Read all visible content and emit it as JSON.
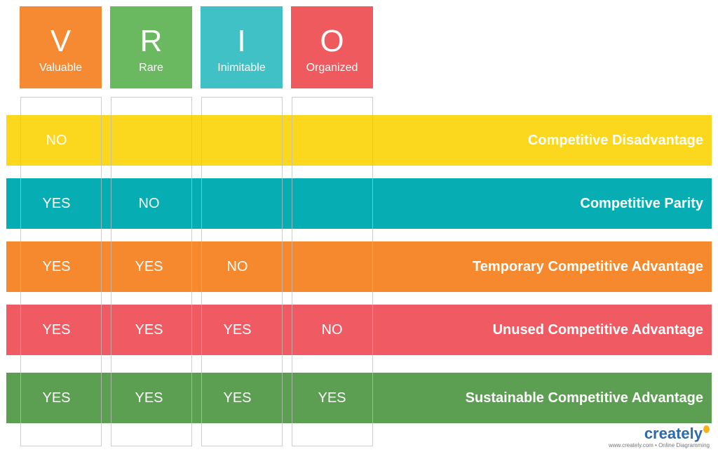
{
  "headers": [
    {
      "letter": "V",
      "word": "Valuable",
      "color": "#f58a32"
    },
    {
      "letter": "R",
      "word": "Rare",
      "color": "#6ab85f"
    },
    {
      "letter": "I",
      "word": "Inimitable",
      "color": "#3fc1c6"
    },
    {
      "letter": "O",
      "word": "Organized",
      "color": "#ef5a5e"
    }
  ],
  "rows": [
    {
      "color": "#fbd71e",
      "cells": [
        "NO",
        "",
        "",
        ""
      ],
      "outcome": "Competitive Disadvantage"
    },
    {
      "color": "#06aeb4",
      "cells": [
        "YES",
        "NO",
        "",
        ""
      ],
      "outcome": "Competitive Parity"
    },
    {
      "color": "#f6892e",
      "cells": [
        "YES",
        "YES",
        "NO",
        ""
      ],
      "outcome": "Temporary Competitive Advantage"
    },
    {
      "color": "#ef5a63",
      "cells": [
        "YES",
        "YES",
        "YES",
        "NO"
      ],
      "outcome": "Unused Competitive Advantage"
    },
    {
      "color": "#5c9e52",
      "cells": [
        "YES",
        "YES",
        "YES",
        "YES"
      ],
      "outcome": "Sustainable Competitive Advantage"
    }
  ],
  "brand": {
    "logo": "creately",
    "tagline": "www.creately.com • Online Diagramming"
  }
}
